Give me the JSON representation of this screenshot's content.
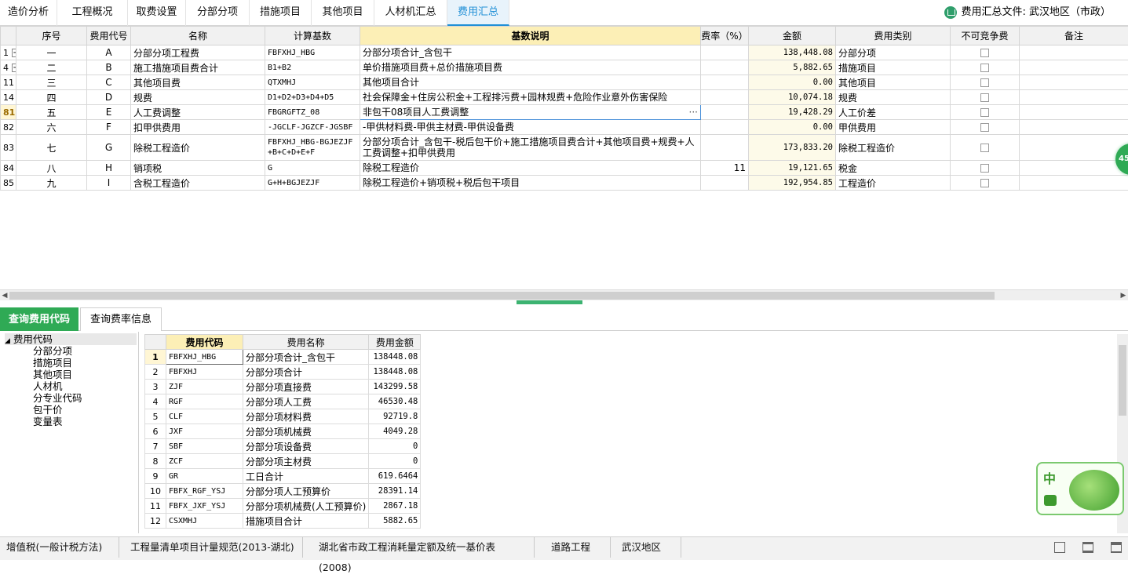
{
  "tabs": [
    "造价分析",
    "工程概况",
    "取费设置",
    "分部分项",
    "措施项目",
    "其他项目",
    "人材机汇总",
    "费用汇总"
  ],
  "active_tab_index": 7,
  "file_info": "费用汇总文件: 武汉地区（市政）",
  "main_table": {
    "headers": [
      "序号",
      "费用代号",
      "名称",
      "计算基数",
      "基数说明",
      "费率（%）",
      "金额",
      "费用类别",
      "不可竞争费",
      "备注"
    ],
    "rows": [
      {
        "num": "1",
        "seq": "一",
        "code": "A",
        "name": "分部分项工程费",
        "base": "FBFXHJ_HBG",
        "desc": "分部分项合计_含包干",
        "rate": "",
        "amount": "138,448.08",
        "category": "分部分项",
        "expand": "+"
      },
      {
        "num": "4",
        "seq": "二",
        "code": "B",
        "name": "施工措施项目费合计",
        "base": "B1+B2",
        "desc": "单价措施项目费+总价措施项目费",
        "rate": "",
        "amount": "5,882.65",
        "category": "措施项目",
        "expand": "+"
      },
      {
        "num": "11",
        "seq": "三",
        "code": "C",
        "name": "其他项目费",
        "base": "QTXMHJ",
        "desc": "其他项目合计",
        "rate": "",
        "amount": "0.00",
        "category": "其他项目",
        "expand": "+"
      },
      {
        "num": "14",
        "seq": "四",
        "code": "D",
        "name": "规费",
        "base": "D1+D2+D3+D4+D5",
        "desc": "社会保障金+住房公积金+工程排污费+园林规费+危险作业意外伤害保险",
        "rate": "",
        "amount": "10,074.18",
        "category": "规费",
        "expand": "+"
      },
      {
        "num": "81",
        "seq": "五",
        "code": "E",
        "name": "人工费调整",
        "base": "FBGRGFTZ_08",
        "desc": "非包干08项目人工费调整",
        "rate": "",
        "amount": "19,428.29",
        "category": "人工价差",
        "expand": ""
      },
      {
        "num": "82",
        "seq": "六",
        "code": "F",
        "name": "扣甲供费用",
        "base": "-JGCLF-JGZCF-JGSBF",
        "desc": "-甲供材料费-甲供主材费-甲供设备费",
        "rate": "",
        "amount": "0.00",
        "category": "甲供费用",
        "expand": ""
      },
      {
        "num": "83",
        "seq": "七",
        "code": "G",
        "name": "除税工程造价",
        "base": "FBFXHJ_HBG-BGJEZJF\n+B+C+D+E+F",
        "desc": "分部分项合计_含包干-税后包干价+施工措施项目费合计+其他项目费+规费+人工费调整+扣甲供费用",
        "rate": "",
        "amount": "173,833.20",
        "category": "除税工程造价",
        "expand": ""
      },
      {
        "num": "84",
        "seq": "八",
        "code": "H",
        "name": "销项税",
        "base": "G",
        "desc": "除税工程造价",
        "rate": "11",
        "amount": "19,121.65",
        "category": "税金",
        "expand": ""
      },
      {
        "num": "85",
        "seq": "九",
        "code": "I",
        "name": "含税工程造价",
        "base": "G+H+BGJEZJF",
        "desc": "除税工程造价+销项税+税后包干项目",
        "rate": "",
        "amount": "192,954.85",
        "category": "工程造价",
        "expand": ""
      }
    ]
  },
  "bottom_tabs": [
    "查询费用代码",
    "查询费率信息"
  ],
  "tree": {
    "root": "费用代码",
    "items": [
      "分部分项",
      "措施项目",
      "其他项目",
      "人材机",
      "分专业代码",
      "包干价",
      "变量表"
    ]
  },
  "code_table": {
    "headers": [
      "费用代码",
      "费用名称",
      "费用金额"
    ],
    "rows": [
      [
        "1",
        "FBFXHJ_HBG",
        "分部分项合计_含包干",
        "138448.08"
      ],
      [
        "2",
        "FBFXHJ",
        "分部分项合计",
        "138448.08"
      ],
      [
        "3",
        "ZJF",
        "分部分项直接费",
        "143299.58"
      ],
      [
        "4",
        "RGF",
        "分部分项人工费",
        "46530.48"
      ],
      [
        "5",
        "CLF",
        "分部分项材料费",
        "92719.8"
      ],
      [
        "6",
        "JXF",
        "分部分项机械费",
        "4049.28"
      ],
      [
        "7",
        "SBF",
        "分部分项设备费",
        "0"
      ],
      [
        "8",
        "ZCF",
        "分部分项主材费",
        "0"
      ],
      [
        "9",
        "GR",
        "工日合计",
        "619.6464"
      ],
      [
        "10",
        "FBFX_RGF_YSJ",
        "分部分项人工预算价",
        "28391.14"
      ],
      [
        "11",
        "FBFX_JXF_YSJ",
        "分部分项机械费(人工预算价)",
        "2867.18"
      ],
      [
        "12",
        "CSXMHJ",
        "措施项目合计",
        "5882.65"
      ]
    ]
  },
  "status_bar": [
    "增值税(一般计税方法)",
    "工程量清单项目计量规范(2013-湖北)",
    "湖北省市政工程消耗量定额及统一基价表(2008)",
    "道路工程",
    "武汉地区"
  ],
  "side_badge": "45",
  "ime_label": "中",
  "accent_color": "#1f8fd6",
  "green_color": "#2faa55"
}
